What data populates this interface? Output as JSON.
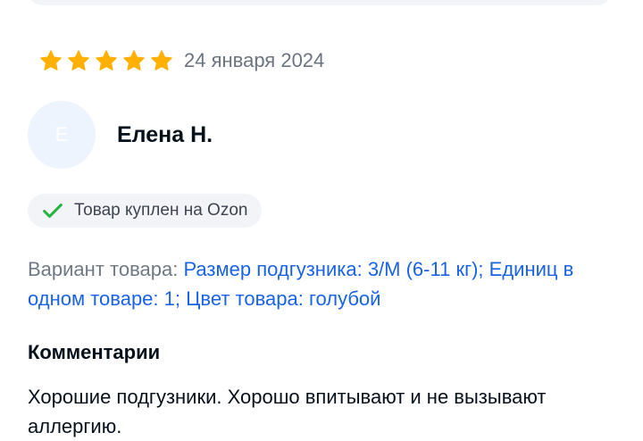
{
  "review": {
    "rating": 5,
    "rating_max": 5,
    "star_color": "#ffb000",
    "date": "24 января 2024",
    "author": {
      "name": "Елена Н.",
      "avatar_letter": "Е"
    },
    "badge": {
      "icon": "check-icon",
      "text": "Товар куплен на Ozon",
      "icon_color": "#25b440"
    },
    "variant": {
      "label": "Вариант товара:",
      "value": "Размер подгузника: 3/M (6-11 кг); Единиц в одном товаре: 1; Цвет товара: голубой"
    },
    "comments_title": "Комментарии",
    "comment": "Хорошие подгузники. Хорошо впитывают и не вызывают аллергию."
  },
  "colors": {
    "link": "#1a63e8",
    "muted": "#707a85",
    "text": "#07111b"
  }
}
